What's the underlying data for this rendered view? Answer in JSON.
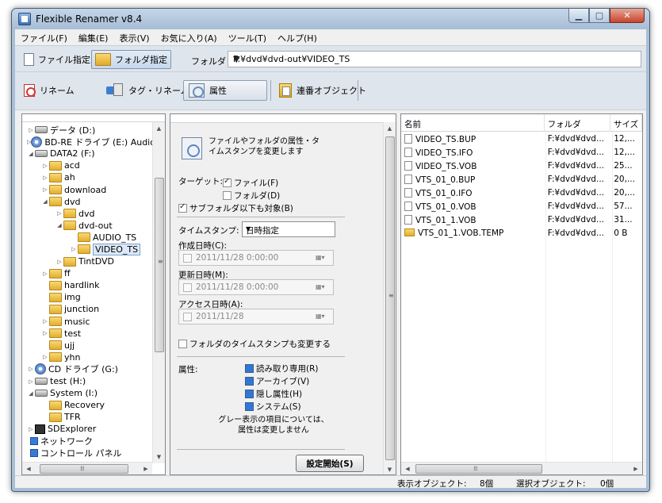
{
  "window": {
    "title": "Flexible Renamer v8.4"
  },
  "menu": [
    "ファイル(F)",
    "編集(E)",
    "表示(V)",
    "お気に入り(A)",
    "ツール(T)",
    "ヘルプ(H)"
  ],
  "toolbar1": {
    "file_mode": "ファイル指定",
    "folder_mode": "フォルダ指定",
    "folder_label": "フォルダ",
    "path": "F:¥dvd¥dvd-out¥VIDEO_TS"
  },
  "toolbar2": {
    "rename": "リネーム",
    "tag_rename": "タグ・リネーム",
    "attributes": "属性",
    "serial_object": "連番オブジェクト"
  },
  "tree": [
    {
      "label": "データ (D:)",
      "icon": "drive-icon",
      "level": 0,
      "twisty": "collapsed"
    },
    {
      "label": "BD-RE ドライブ (E:) Audio",
      "icon": "cd-drive-icon",
      "level": 0,
      "twisty": "collapsed"
    },
    {
      "label": "DATA2 (F:)",
      "icon": "drive-icon",
      "level": 0,
      "twisty": "expanded"
    },
    {
      "label": "acd",
      "icon": "folder-icon",
      "level": 1,
      "twisty": "collapsed"
    },
    {
      "label": "ah",
      "icon": "folder-icon",
      "level": 1,
      "twisty": "collapsed"
    },
    {
      "label": "download",
      "icon": "folder-icon",
      "level": 1,
      "twisty": "collapsed"
    },
    {
      "label": "dvd",
      "icon": "folder-icon",
      "level": 1,
      "twisty": "expanded"
    },
    {
      "label": "dvd",
      "icon": "folder-icon",
      "level": 2,
      "twisty": "collapsed"
    },
    {
      "label": "dvd-out",
      "icon": "folder-icon",
      "level": 2,
      "twisty": "expanded"
    },
    {
      "label": "AUDIO_TS",
      "icon": "folder-icon",
      "level": 3,
      "twisty": "none"
    },
    {
      "label": "VIDEO_TS",
      "icon": "folder-icon",
      "level": 3,
      "twisty": "collapsed",
      "selected": true
    },
    {
      "label": "TintDVD",
      "icon": "folder-icon",
      "level": 2,
      "twisty": "collapsed"
    },
    {
      "label": "ff",
      "icon": "folder-icon",
      "level": 1,
      "twisty": "collapsed"
    },
    {
      "label": "hardlink",
      "icon": "folder-icon",
      "level": 1,
      "twisty": "none"
    },
    {
      "label": "img",
      "icon": "folder-icon",
      "level": 1,
      "twisty": "none"
    },
    {
      "label": "junction",
      "icon": "folder-icon",
      "level": 1,
      "twisty": "none"
    },
    {
      "label": "music",
      "icon": "folder-icon",
      "level": 1,
      "twisty": "collapsed"
    },
    {
      "label": "test",
      "icon": "folder-icon",
      "level": 1,
      "twisty": "collapsed"
    },
    {
      "label": "ujj",
      "icon": "folder-icon",
      "level": 1,
      "twisty": "none"
    },
    {
      "label": "yhn",
      "icon": "folder-icon",
      "level": 1,
      "twisty": "collapsed"
    },
    {
      "label": "CD ドライブ (G:)",
      "icon": "cd-drive-icon",
      "level": 0,
      "twisty": "collapsed"
    },
    {
      "label": "test (H:)",
      "icon": "drive-icon",
      "level": 0,
      "twisty": "collapsed"
    },
    {
      "label": "System (I:)",
      "icon": "drive-icon",
      "level": 0,
      "twisty": "expanded"
    },
    {
      "label": "Recovery",
      "icon": "folder-icon",
      "level": 1,
      "twisty": "none"
    },
    {
      "label": "TFR",
      "icon": "folder-icon",
      "level": 1,
      "twisty": "none"
    },
    {
      "label": "SDExplorer",
      "icon": "app-icon",
      "level": 0,
      "twisty": "collapsed"
    },
    {
      "label": "ネットワーク",
      "icon": "network-icon",
      "level": -1,
      "twisty": "none"
    },
    {
      "label": "コントロール パネル",
      "icon": "network-icon",
      "level": -1,
      "twisty": "none"
    }
  ],
  "attr_panel": {
    "heading": "ファイルやフォルダの属性・タイムスタンプを変更します",
    "target_label": "ターゲット:",
    "target_file": "ファイル(F)",
    "target_folder": "フォルダ(D)",
    "include_subfolders": "サブフォルダ以下も対象(B)",
    "timestamp_label": "タイムスタンプ:",
    "timestamp_mode": "日時指定",
    "created_label": "作成日時(C):",
    "created_value": "2011/11/28   0:00:00",
    "modified_label": "更新日時(M):",
    "modified_value": "2011/11/28   0:00:00",
    "accessed_label": "アクセス日時(A):",
    "accessed_value": "2011/11/28",
    "folder_timestamp": "フォルダのタイムスタンプも変更する",
    "attributes_label": "属性:",
    "attr_readonly": "読み取り専用(R)",
    "attr_archive": "アーカイブ(V)",
    "attr_hidden": "隠し属性(H)",
    "attr_system": "システム(S)",
    "note_line1": "グレー表示の項目については、",
    "note_line2": "属性は変更しません",
    "start_button": "設定開始(S)"
  },
  "file_list": {
    "columns": [
      "名前",
      "フォルダ",
      "サイズ"
    ],
    "rows": [
      {
        "name": "VIDEO_TS.BUP",
        "folder": "F:¥dvd¥dvd...",
        "size": "12,...",
        "type": "file"
      },
      {
        "name": "VIDEO_TS.IFO",
        "folder": "F:¥dvd¥dvd...",
        "size": "12,...",
        "type": "file"
      },
      {
        "name": "VIDEO_TS.VOB",
        "folder": "F:¥dvd¥dvd...",
        "size": "25...",
        "type": "file"
      },
      {
        "name": "VTS_01_0.BUP",
        "folder": "F:¥dvd¥dvd...",
        "size": "20,...",
        "type": "file"
      },
      {
        "name": "VTS_01_0.IFO",
        "folder": "F:¥dvd¥dvd...",
        "size": "20,...",
        "type": "file"
      },
      {
        "name": "VTS_01_0.VOB",
        "folder": "F:¥dvd¥dvd...",
        "size": "57...",
        "type": "file"
      },
      {
        "name": "VTS_01_1.VOB",
        "folder": "F:¥dvd¥dvd...",
        "size": "31...",
        "type": "file"
      },
      {
        "name": "VTS_01_1.VOB.TEMP",
        "folder": "F:¥dvd¥dvd...",
        "size": "0 B",
        "type": "folder"
      }
    ]
  },
  "status": {
    "shown_label": "表示オブジェクト:",
    "shown_count": "8個",
    "selected_label": "選択オブジェクト:",
    "selected_count": "0個"
  }
}
